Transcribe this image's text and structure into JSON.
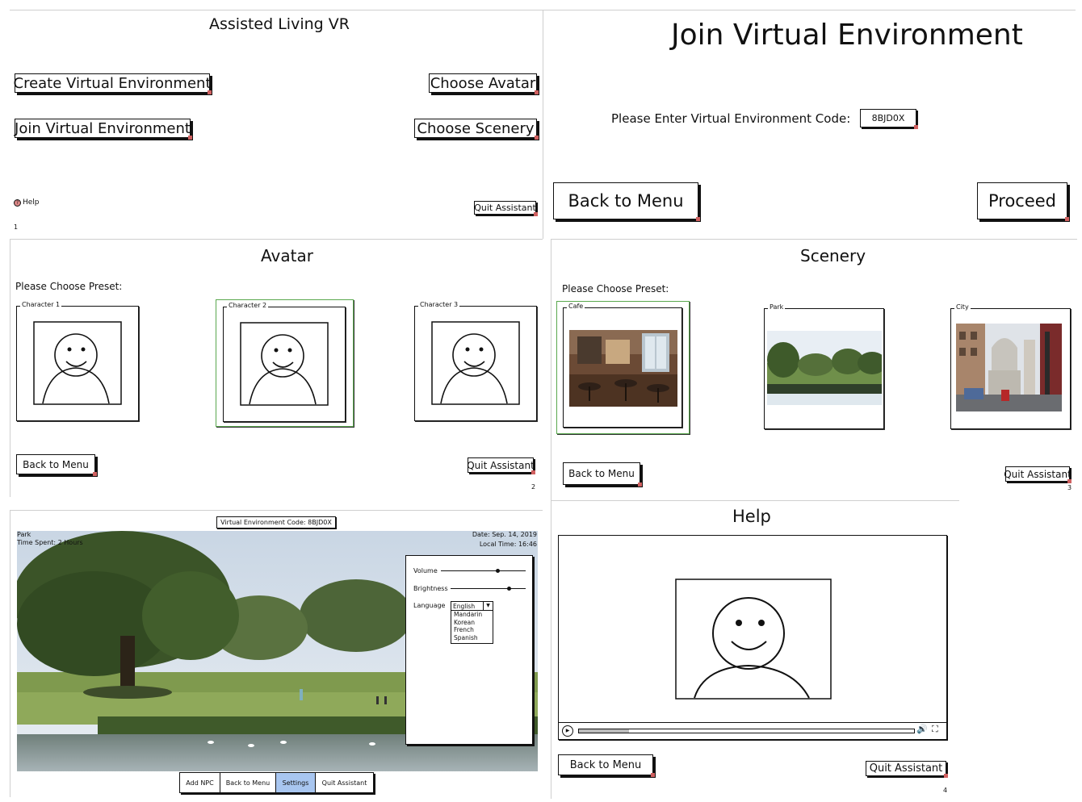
{
  "main_menu": {
    "title": "Assisted Living VR",
    "create_button": "Create Virtual Environment",
    "choose_avatar_button": "Choose Avatar",
    "join_button": "Join Virtual Environment",
    "choose_scenery_button": "Choose Scenery",
    "help_link": "Help",
    "quit_button": "Quit Assistant",
    "page_number": "1"
  },
  "join": {
    "title": "Join Virtual Environment",
    "code_label": "Please Enter Virtual Environment Code:",
    "code_value": "8BJD0X",
    "back_button": "Back to Menu",
    "proceed_button": "Proceed"
  },
  "avatar": {
    "title": "Avatar",
    "prompt": "Please Choose Preset:",
    "presets": [
      "Character 1",
      "Character 2",
      "Character 3"
    ],
    "selected_index": 1,
    "back_button": "Back to Menu",
    "quit_button": "Quit Assistant",
    "page_number": "2"
  },
  "scenery": {
    "title": "Scenery",
    "prompt": "Please Choose Preset:",
    "presets": [
      "Cafe",
      "Park",
      "City"
    ],
    "selected_index": 0,
    "back_button": "Back to Menu",
    "quit_button": "Quit Assistant",
    "page_number": "3"
  },
  "environment": {
    "code_banner": "Virtual Environment Code: 8BJD0X",
    "location": "Park",
    "time_spent": "Time Spent: 2 Hours",
    "date": "Date: Sep. 14, 2019",
    "local_time": "Local Time: 16:46",
    "settings": {
      "volume_label": "Volume",
      "volume_level": 0.65,
      "brightness_label": "Brightness",
      "brightness_level": 0.75,
      "language_label": "Language",
      "language_selected": "English",
      "language_options": [
        "Mandarin",
        "Korean",
        "French",
        "Spanish"
      ]
    },
    "toolbar": {
      "add_npc": "Add NPC",
      "back": "Back to Menu",
      "settings": "Settings",
      "quit": "Quit Assistant"
    }
  },
  "help": {
    "title": "Help",
    "back_button": "Back to Menu",
    "quit_button": "Quit Assistant",
    "page_number": "4"
  },
  "colors": {
    "selected_border": "#5aa84e",
    "settings_highlight": "#a8c6f0",
    "corner_mark": "#d06060"
  }
}
